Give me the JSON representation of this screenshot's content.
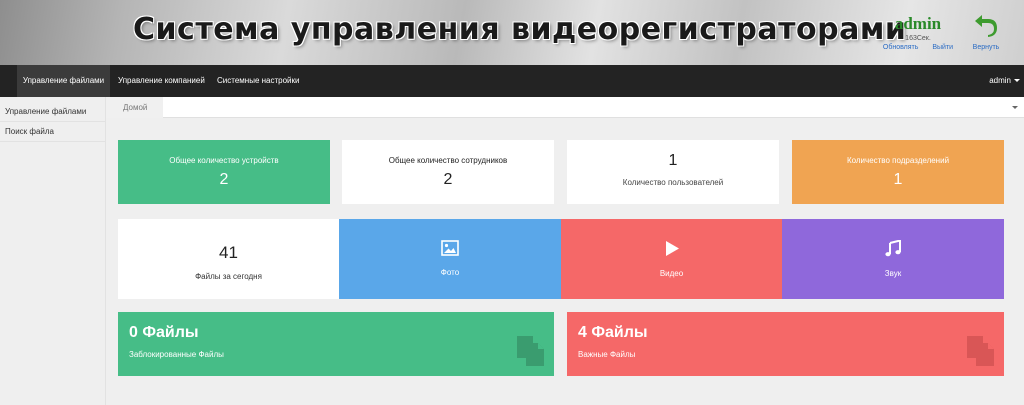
{
  "header": {
    "title": "Система управления видеорегистраторами",
    "user_name": "admin",
    "session_time": "163Сек.",
    "refresh_label": "Обновлять",
    "logout_label": "Выйти",
    "return_label": "Вернуть"
  },
  "navbar": {
    "items": [
      "Управление файлами",
      "Управление компанией",
      "Системные настройки"
    ],
    "user": "admin"
  },
  "sidebar": {
    "items": [
      "Управление файлами",
      "Поиск файла"
    ]
  },
  "breadcrumb": {
    "home": "Домой"
  },
  "stats": {
    "devices": {
      "label": "Общее количество устройств",
      "value": "2"
    },
    "employees": {
      "label": "Общее количество сотрудников",
      "value": "2"
    },
    "users": {
      "label": "Количество пользователей",
      "value": "1"
    },
    "departments": {
      "label": "Количество подразделений",
      "value": "1"
    },
    "today_files": {
      "label": "Файлы за сегодня",
      "value": "41"
    }
  },
  "media": {
    "photo": "Фото",
    "video": "Видео",
    "sound": "Звук"
  },
  "file_boxes": {
    "locked": {
      "count": "0 Файлы",
      "label": "Заблокированные Файлы"
    },
    "important": {
      "count": "4 Файлы",
      "label": "Важные Файлы"
    }
  },
  "colors": {
    "green": "#46bd87",
    "orange": "#f0a452",
    "blue": "#5aa7e9",
    "red": "#f56868",
    "purple": "#8f68db",
    "navbar": "#232323",
    "user_name": "#2a8a2a"
  },
  "icons": {
    "photo": "image-icon",
    "video": "play-icon",
    "sound": "music-icon",
    "return": "return-arrow-icon",
    "files": "files-icon"
  }
}
